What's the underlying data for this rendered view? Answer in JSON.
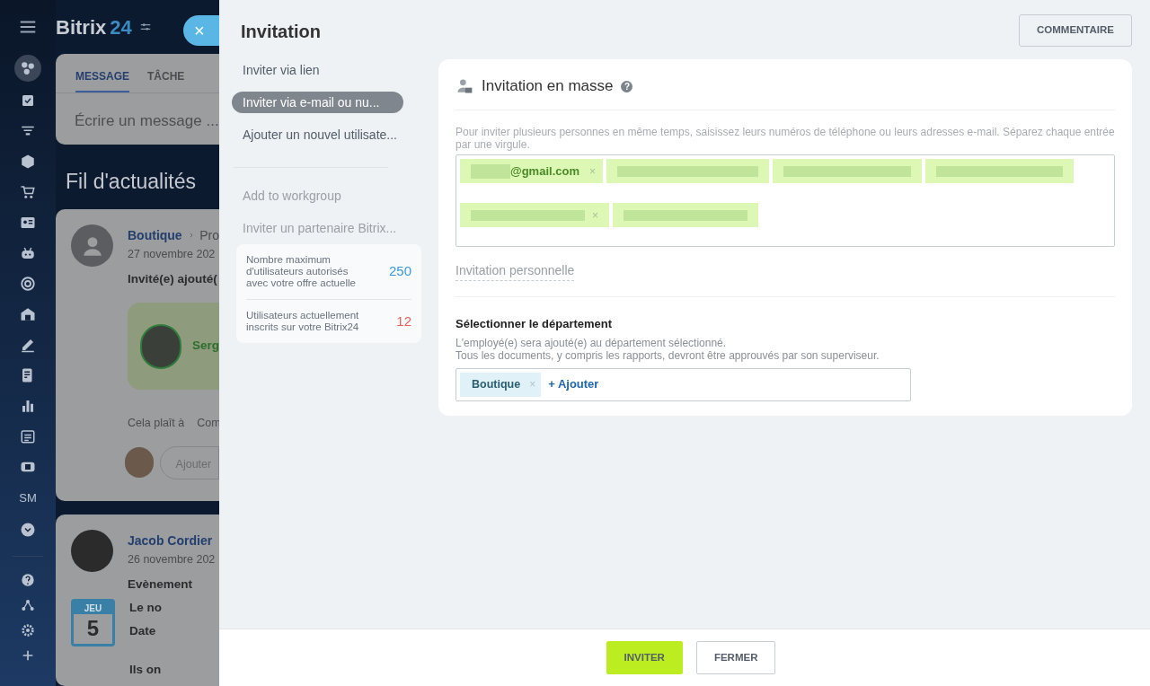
{
  "app": {
    "logo_word": "Bitrix",
    "logo_number": "24",
    "nav_text_item": "SM"
  },
  "feed": {
    "composer_tabs": [
      {
        "label": "MESSAGE",
        "selected": true
      },
      {
        "label": "TÂCHE",
        "selected": false
      }
    ],
    "composer_placeholder": "Écrire un message ...",
    "title": "Fil d'actualités",
    "posts": [
      {
        "kind": "invite",
        "author": "Boutique",
        "target": "Pro",
        "date": "27 novembre 202",
        "headline": "Invité(e) ajouté(",
        "person": "Serg",
        "actions": [
          "Cela plaît à",
          "Com"
        ],
        "comment_placeholder": "Ajouter"
      },
      {
        "kind": "event",
        "author": "Jacob Cordier",
        "date": "26 novembre 202",
        "headline": "Evènement",
        "day_name": "JEU",
        "day": "5",
        "lines": [
          "Le no",
          "Date",
          "Ils on"
        ]
      }
    ]
  },
  "slider": {
    "close": "×",
    "title": "Invitation",
    "comment_button": "COMMENTAIRE",
    "menu": [
      {
        "label": "Inviter via lien",
        "selected": false,
        "disabled": false
      },
      {
        "label": "Inviter via e-mail ou nu...",
        "selected": true,
        "disabled": false
      },
      {
        "label": "Ajouter un nouvel utilisate...",
        "selected": false,
        "disabled": false
      },
      {
        "label": "Add to workgroup",
        "selected": false,
        "disabled": true
      },
      {
        "label": "Inviter un partenaire Bitrix...",
        "selected": false,
        "disabled": true
      }
    ],
    "stats": [
      {
        "label": "Nombre maximum d'utilisateurs autorisés avec votre offre actuelle",
        "value": "250",
        "color": "#3a9ad9"
      },
      {
        "label": "Utilisateurs actuellement inscrits sur votre Bitrix24",
        "value": "12",
        "color": "#e8635a"
      }
    ],
    "mass_invite": {
      "title": "Invitation en masse",
      "help": "?",
      "hint": "Pour inviter plusieurs personnes en même temps, saisissez leurs numéros de téléphone ou leurs adresses e-mail. Séparez chaque entrée par une virgule.",
      "entries": [
        {
          "kind": "text",
          "text": "@gmail.com",
          "remove": "×"
        },
        {
          "kind": "redacted"
        },
        {
          "kind": "redacted"
        },
        {
          "kind": "redacted"
        },
        {
          "kind": "redacted",
          "remove": "×"
        },
        {
          "kind": "redacted"
        }
      ],
      "personal_link": "Invitation personnelle"
    },
    "department": {
      "title": "Sélectionner le département",
      "hint": [
        "L'employé(e) sera ajouté(e) au département sélectionné.",
        "Tous les documents, y compris les rapports, devront être approuvés par son superviseur."
      ],
      "tags": [
        {
          "label": "Boutique",
          "remove": "×"
        }
      ],
      "add": "+ Ajouter"
    },
    "footer_buttons": [
      {
        "label": "INVITER",
        "kind": "primary"
      },
      {
        "label": "FERMER",
        "kind": "secondary"
      }
    ]
  }
}
